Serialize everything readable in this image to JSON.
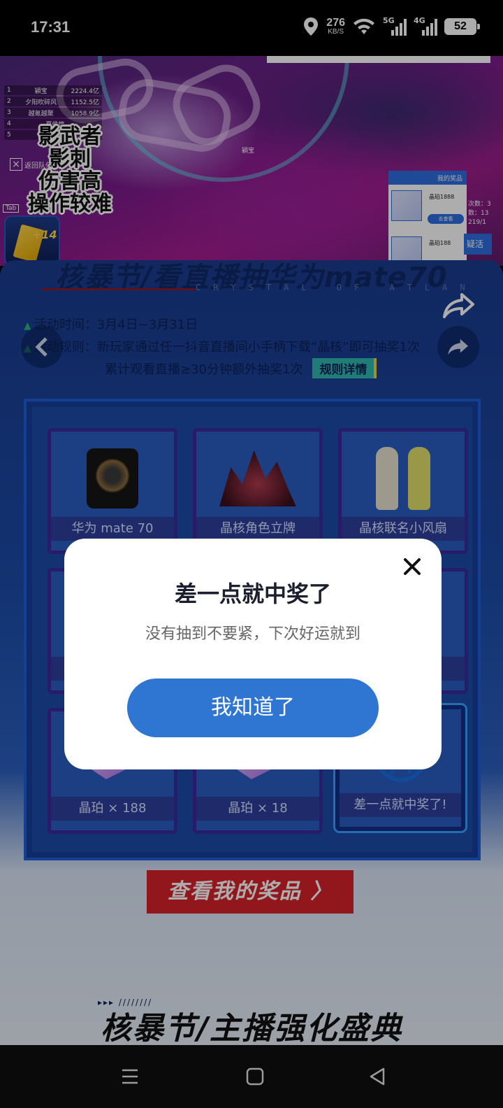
{
  "status_bar": {
    "time": "17:31",
    "net_speed_value": "276",
    "net_speed_unit": "KB/S",
    "signal1_label": "5G",
    "signal2_label": "4G",
    "battery": "52",
    "icons": [
      "location-icon",
      "wifi-icon",
      "signal-5g-icon",
      "signal-4g-icon",
      "battery-icon"
    ]
  },
  "live_stream": {
    "banner_text": "",
    "leaderboard": [
      {
        "rank": "1",
        "name": "穎宝",
        "score": "2224.4亿"
      },
      {
        "rank": "2",
        "name": "夕阳吹碎风",
        "score": "1152.5亿"
      },
      {
        "rank": "3",
        "name": "越氪越聚",
        "score": "1058.9亿"
      },
      {
        "rank": "4",
        "name": "夏侯惇",
        "score": ""
      },
      {
        "rank": "5",
        "name": "转账",
        "score": ""
      }
    ],
    "caption_lines": [
      "影武者",
      "影刺",
      "伤害高",
      "操作较难"
    ],
    "back_to_team": "返回队伍",
    "tab_hint": "Tab",
    "player_tag": "穎宝",
    "gift_badge": "+14",
    "prize_panel": {
      "header": "我的奖品",
      "items": [
        {
          "name": "晶珀1888",
          "button": "去查看"
        },
        {
          "name": "晶珀188",
          "button": ""
        }
      ]
    },
    "side_stats": [
      "次数：3",
      "数：13",
      "219/1"
    ],
    "side_button": "疑活"
  },
  "event": {
    "title": "核暴节/看直播抽华为mate70",
    "title_sub": "CRYSTAL OF ATLAN",
    "time_label": "活动时间：3月4日~3月31日",
    "rule_line1": "活动规则：新玩家通过任一抖音直播间小手柄下载“晶核”即可抽奖1次",
    "rule_line2": "累计观看直播≥30分钟额外抽奖1次",
    "rule_detail_button": "规则详情",
    "prizes": [
      {
        "label": "华为 mate 70",
        "image": "phone"
      },
      {
        "label": "晶核角色立牌",
        "image": "figure"
      },
      {
        "label": "晶核联名小风扇",
        "image": "fan"
      },
      {
        "label": "",
        "image": "blank"
      },
      {
        "label": "",
        "image": "blank"
      },
      {
        "label": "",
        "image": "blank"
      },
      {
        "label": "晶珀 × 188",
        "image": "crystal"
      },
      {
        "label": "晶珀 × 18",
        "image": "crystal"
      },
      {
        "label": "差一点就中奖了!",
        "image": "sad-face"
      }
    ],
    "my_prizes_button": "查看我的奖品 〉",
    "section_title": "核暴节/主播强化盛典"
  },
  "modal": {
    "title": "差一点就中奖了",
    "subtitle": "没有抽到不要紧，下次好运就到",
    "confirm_button": "我知道了"
  },
  "colors": {
    "accent_blue": "#2f76d2",
    "event_bg": "#1b4aa6",
    "prize_button_red": "#d8222c"
  }
}
